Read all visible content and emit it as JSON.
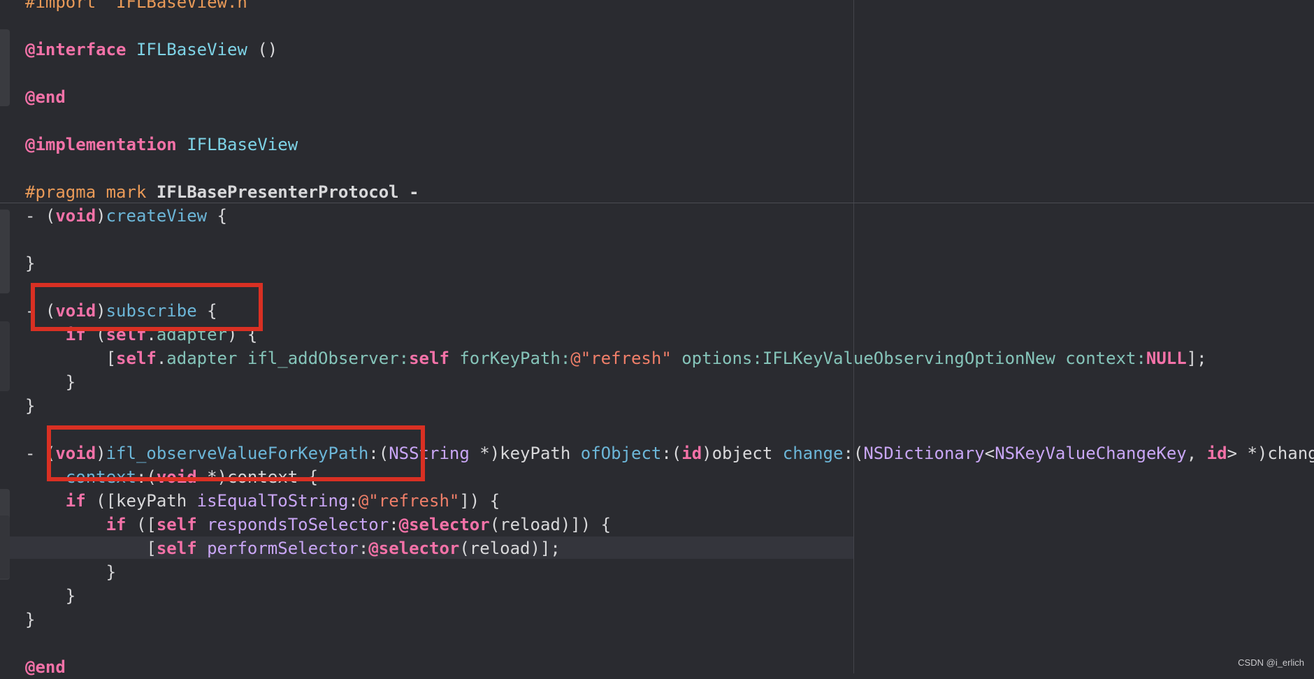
{
  "code_lines": [
    [
      {
        "t": "#import \"IFLBaseView.h\"",
        "c": "pp"
      }
    ],
    [],
    [
      {
        "t": "@interface",
        "c": "kw"
      },
      {
        "t": " "
      },
      {
        "t": "IFLBaseView",
        "c": "ty"
      },
      {
        "t": " ()"
      }
    ],
    [],
    [
      {
        "t": "@end",
        "c": "kw"
      }
    ],
    [],
    [
      {
        "t": "@implementation",
        "c": "kw"
      },
      {
        "t": " "
      },
      {
        "t": "IFLBaseView",
        "c": "ty"
      }
    ],
    [],
    [
      {
        "t": "#pragma mark",
        "c": "pp"
      },
      {
        "t": " IFLBasePresenterProtocol -",
        "c": "bd"
      }
    ],
    [
      {
        "t": "- ("
      },
      {
        "t": "void",
        "c": "kw"
      },
      {
        "t": ")"
      },
      {
        "t": "createView",
        "c": "fn"
      },
      {
        "t": " {"
      }
    ],
    [],
    [
      {
        "t": "}"
      }
    ],
    [],
    [
      {
        "t": "- ("
      },
      {
        "t": "void",
        "c": "kw"
      },
      {
        "t": ")"
      },
      {
        "t": "subscribe",
        "c": "fn"
      },
      {
        "t": " {"
      }
    ],
    [
      {
        "t": "    "
      },
      {
        "t": "if",
        "c": "kw"
      },
      {
        "t": " ("
      },
      {
        "t": "self",
        "c": "kw"
      },
      {
        "t": "."
      },
      {
        "t": "adapter",
        "c": "pr"
      },
      {
        "t": ") {"
      }
    ],
    [
      {
        "t": "        ["
      },
      {
        "t": "self",
        "c": "kw"
      },
      {
        "t": "."
      },
      {
        "t": "adapter",
        "c": "pr"
      },
      {
        "t": " ifl_addObserver:",
        "c": "pr"
      },
      {
        "t": "self",
        "c": "kw"
      },
      {
        "t": " forKeyPath:",
        "c": "pr"
      },
      {
        "t": "@\"refresh\"",
        "c": "st"
      },
      {
        "t": " options:",
        "c": "pr"
      },
      {
        "t": "IFLKeyValueObservingOptionNew",
        "c": "pr"
      },
      {
        "t": " context:",
        "c": "pr"
      },
      {
        "t": "NULL",
        "c": "kw"
      },
      {
        "t": "];"
      }
    ],
    [
      {
        "t": "    }"
      }
    ],
    [
      {
        "t": "}"
      }
    ],
    [],
    [
      {
        "t": "- ("
      },
      {
        "t": "void",
        "c": "kw"
      },
      {
        "t": ")"
      },
      {
        "t": "ifl_observeValueForKeyPath",
        "c": "fn"
      },
      {
        "t": ":("
      },
      {
        "t": "NSString",
        "c": "cl"
      },
      {
        "t": " *)keyPath "
      },
      {
        "t": "ofObject",
        "c": "fn"
      },
      {
        "t": ":("
      },
      {
        "t": "id",
        "c": "kw"
      },
      {
        "t": ")object "
      },
      {
        "t": "change",
        "c": "fn"
      },
      {
        "t": ":("
      },
      {
        "t": "NSDictionary",
        "c": "cl"
      },
      {
        "t": "<"
      },
      {
        "t": "NSKeyValueChangeKey",
        "c": "cl"
      },
      {
        "t": ", "
      },
      {
        "t": "id",
        "c": "kw"
      },
      {
        "t": "> *)change"
      }
    ],
    [
      {
        "t": "    "
      },
      {
        "t": "context",
        "c": "fn"
      },
      {
        "t": ":("
      },
      {
        "t": "void",
        "c": "kw"
      },
      {
        "t": " *)context {"
      }
    ],
    [
      {
        "t": "    "
      },
      {
        "t": "if",
        "c": "kw"
      },
      {
        "t": " ([keyPath "
      },
      {
        "t": "isEqualToString",
        "c": "cl"
      },
      {
        "t": ":"
      },
      {
        "t": "@\"refresh\"",
        "c": "st"
      },
      {
        "t": "]) {"
      }
    ],
    [
      {
        "t": "        "
      },
      {
        "t": "if",
        "c": "kw"
      },
      {
        "t": " (["
      },
      {
        "t": "self",
        "c": "kw"
      },
      {
        "t": " "
      },
      {
        "t": "respondsToSelector",
        "c": "cl"
      },
      {
        "t": ":"
      },
      {
        "t": "@selector",
        "c": "kw"
      },
      {
        "t": "(reload)]) {"
      }
    ],
    [
      {
        "t": "            ["
      },
      {
        "t": "self",
        "c": "kw"
      },
      {
        "t": " "
      },
      {
        "t": "performSelector",
        "c": "cl"
      },
      {
        "t": ":"
      },
      {
        "t": "@selector",
        "c": "kw"
      },
      {
        "t": "(reload)];"
      }
    ],
    [
      {
        "t": "        }"
      }
    ],
    [
      {
        "t": "    }"
      }
    ],
    [
      {
        "t": "}"
      }
    ],
    [],
    [
      {
        "t": "@end",
        "c": "kw"
      }
    ]
  ],
  "watermark": "CSDN @i_erlich",
  "colors": {
    "background": "#2a2b30",
    "keyword": "#f472a8",
    "type": "#7ed3e6",
    "method": "#6cb6d8",
    "string": "#f07f69",
    "preprocessor": "#e99a58",
    "class": "#c9a6f5",
    "property": "#85c4b9",
    "annotation_box": "#d93023"
  }
}
